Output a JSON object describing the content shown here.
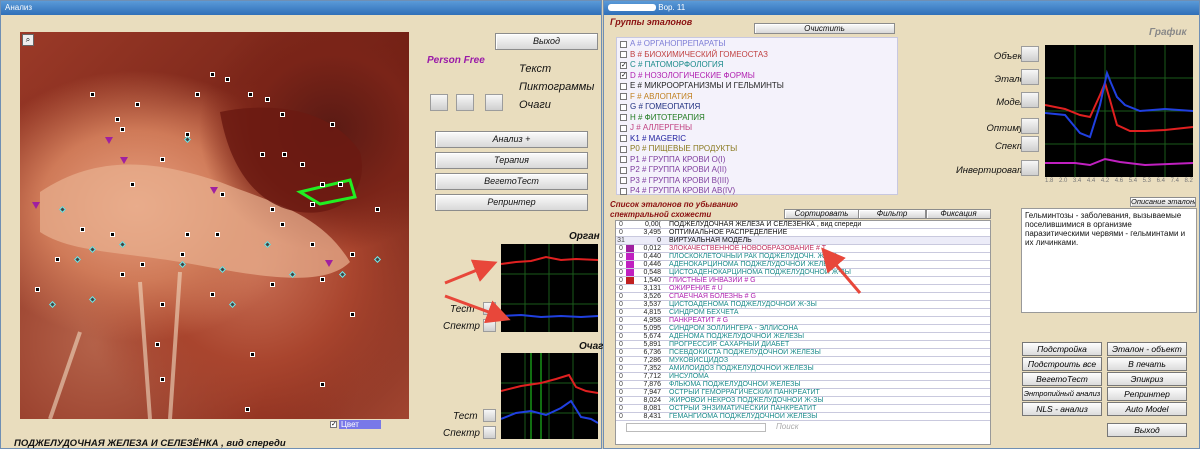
{
  "left": {
    "window_title": "Анализ",
    "exit_label": "Выход",
    "person_label": "Person Free",
    "text_label": "Текст",
    "pict_label": "Пиктограммы",
    "foci_label": "Очаги",
    "buttons": [
      "Анализ +",
      "Терапия",
      "ВегетоТест",
      "Репринтер"
    ],
    "organ_label": "Орган",
    "foci_graph_label": "Очаг",
    "test_label": "Тест",
    "spectr_label": "Спектр",
    "caption": "ПОДЖЕЛУДОЧНАЯ  ЖЕЛЕЗА  И  СЕЛЕЗЁНКА , вид спереди",
    "color_checkbox_label": "Цвет"
  },
  "right": {
    "window_title": "Вор. 11",
    "groups_title": "Группы эталонов",
    "clear_label": "Очистить",
    "groups": [
      {
        "text": "A # ОРГАНОПРЕПАРАТЫ",
        "color": "#7d7dd6",
        "checked": false
      },
      {
        "text": "B # БИОХИМИЧЕСКИЙ  ГОМЕОСТАЗ",
        "color": "#c04040",
        "checked": false
      },
      {
        "text": "C # ПАТОМОРФОЛОГИЯ",
        "color": "#1a8a8a",
        "checked": true
      },
      {
        "text": "D # НОЗОЛОГИЧЕСКИЕ  ФОРМЫ",
        "color": "#b020b0",
        "checked": true
      },
      {
        "text": "E # МИКРООРГАНИЗМЫ   И   ГЕЛЬМИНТЫ",
        "color": "#222222",
        "checked": false
      },
      {
        "text": "F # АВЛОПАТИЯ",
        "color": "#c08020",
        "checked": false
      },
      {
        "text": "G # ГОМЕОПАТИЯ",
        "color": "#203080",
        "checked": false
      },
      {
        "text": "H # ФИТОТЕРАПИЯ",
        "color": "#207a20",
        "checked": false
      },
      {
        "text": "J # АЛЛЕРГЕНЫ",
        "color": "#c04080",
        "checked": false
      },
      {
        "text": "K1 # MAGERIC",
        "color": "#2020a0",
        "checked": false
      },
      {
        "text": "P0 # ПИЩЕВЫЕ  ПРОДУКТЫ",
        "color": "#8a7a20",
        "checked": false
      },
      {
        "text": "P1 # ГРУППА КРОВИ O(I)",
        "color": "#8040a0",
        "checked": false
      },
      {
        "text": "P2 # ГРУППА КРОВИ A(II)",
        "color": "#8040a0",
        "checked": false
      },
      {
        "text": "P3 # ГРУППА КРОВИ B(III)",
        "color": "#8040a0",
        "checked": false
      },
      {
        "text": "P4 # ГРУППА КРОВИ AB(IV)",
        "color": "#8040a0",
        "checked": false
      }
    ],
    "graph_title": "График",
    "graph_labels": [
      "Объект",
      "Эталон",
      "Модель",
      "Оптимум",
      "Спектр",
      "Инвертировать"
    ],
    "graph_x_ticks": [
      "1.8",
      "2.0",
      "3.4",
      "4.4",
      "4.2",
      "4.6",
      "5.4",
      "5.3",
      "6.4",
      "7.4",
      "8.2"
    ],
    "list_title": "Список эталонов по убыванию спектральной схожести",
    "sort_label": "Сортировать",
    "filter_label": "Фильтр",
    "fix_label": "Фиксация",
    "desc_button": "Описание эталона",
    "description": "Гельминтозы - заболевания, вызываемые поселившимися в организме паразитическими червями - гельминтами и их личинками.",
    "search_label": "Поиск",
    "etalons": [
      {
        "n": "0",
        "val": "0,00(",
        "name": "ПОДЖЕЛУДОЧНАЯ ЖЕЛЕЗА  И  СЕЛЕЗЁНКА , вид спереди",
        "color": "#111111",
        "mark": ""
      },
      {
        "n": "0",
        "val": "3,495",
        "name": "ОПТИМАЛЬНОЕ РАСПРЕДЕЛЕНИЕ",
        "color": "#111111",
        "mark": ""
      },
      {
        "n": "31",
        "val": "0",
        "name": "ВИРТУАЛЬНАЯ МОДЕЛЬ",
        "color": "#111111",
        "mark": ""
      },
      {
        "n": "0",
        "val": "0,012",
        "name": "ЗЛОКАЧЕСТВЕННОЕ  НОВООБРАЗОВАНИЕ # T",
        "color": "#c03060",
        "mark": "#a020a0"
      },
      {
        "n": "0",
        "val": "0,440",
        "name": "ПЛОСКОКЛЕТОЧНЫЙ  РАК  ПОДЖЕЛУДОЧН. Ж-ЗЫ",
        "color": "#1a8a8a",
        "mark": "#c020c0"
      },
      {
        "n": "0",
        "val": "0,446",
        "name": "АДЕНОКАРЦИНОМА  ПОДЖЕЛУДОЧНОЙ  ЖЕЛЕЗЫ",
        "color": "#1a8a8a",
        "mark": "#c020c0"
      },
      {
        "n": "0",
        "val": "0,548",
        "name": "ЦИСТОАДЕНОКАРЦИНОМА  ПОДЖЕЛУДОЧНОЙ  Ж-ЗЫ",
        "color": "#1a8a8a",
        "mark": "#c020c0"
      },
      {
        "n": "0",
        "val": "1,540",
        "name": "ГЛИСТНЫЕ  ИНВАЗИИ # G",
        "color": "#b020b0",
        "mark": "#c02020"
      },
      {
        "n": "0",
        "val": "3,131",
        "name": "ОЖИРЕНИЕ # U",
        "color": "#b020b0",
        "mark": ""
      },
      {
        "n": "0",
        "val": "3,526",
        "name": "СПАЕЧНАЯ  БОЛЕЗНЬ # G",
        "color": "#b020b0",
        "mark": ""
      },
      {
        "n": "0",
        "val": "3,537",
        "name": "ЦИСТОАДЕНОМА  ПОДЖЕЛУДОЧНОЙ  Ж-ЗЫ",
        "color": "#1a8a8a",
        "mark": ""
      },
      {
        "n": "0",
        "val": "4,815",
        "name": "СИНДРОМ  БЕХЧЕТА",
        "color": "#1a8a8a",
        "mark": ""
      },
      {
        "n": "0",
        "val": "4,958",
        "name": "ПАНКРЕАТИТ # G",
        "color": "#b020b0",
        "mark": ""
      },
      {
        "n": "0",
        "val": "5,095",
        "name": "СИНДРОМ  ЗОЛЛИНГЕРА - ЭЛЛИСОНА",
        "color": "#1a8a8a",
        "mark": ""
      },
      {
        "n": "0",
        "val": "5,674",
        "name": "АДЕНОМА  ПОДЖЕЛУДОЧНОЙ  ЖЕЛЕЗЫ",
        "color": "#1a8a8a",
        "mark": ""
      },
      {
        "n": "0",
        "val": "5,891",
        "name": "ПРОГРЕССИР. САХАРНЫЙ  ДИАБЕТ",
        "color": "#1a8a8a",
        "mark": ""
      },
      {
        "n": "0",
        "val": "6,736",
        "name": "ПСЕВДОКИСТА  ПОДЖЕЛУДОЧНОЙ  ЖЕЛЕЗЫ",
        "color": "#1a8a8a",
        "mark": ""
      },
      {
        "n": "0",
        "val": "7,286",
        "name": "МУКОВИСЦИДОЗ",
        "color": "#1a8a8a",
        "mark": ""
      },
      {
        "n": "0",
        "val": "7,352",
        "name": "АМИЛОИДОЗ  ПОДЖЕЛУДОЧНОЙ  ЖЕЛЕЗЫ",
        "color": "#1a8a8a",
        "mark": ""
      },
      {
        "n": "0",
        "val": "7,712",
        "name": "ИНСУЛОМА",
        "color": "#1a8a8a",
        "mark": ""
      },
      {
        "n": "0",
        "val": "7,876",
        "name": "ФЛЬЮМА  ПОДЖЕЛУДОЧНОЙ  ЖЕЛЕЗЫ",
        "color": "#1a8a8a",
        "mark": ""
      },
      {
        "n": "0",
        "val": "7,947",
        "name": "ОСТРЫЙ  ГЕМОРРАГИЧЕСКИЙ  ПАНКРЕАТИТ",
        "color": "#1a8a8a",
        "mark": ""
      },
      {
        "n": "0",
        "val": "8,024",
        "name": "ЖИРОВОЙ  НЕКРОЗ  ПОДЖЕЛУДОЧНОЙ  Ж-ЗЫ",
        "color": "#1a8a8a",
        "mark": ""
      },
      {
        "n": "0",
        "val": "8,081",
        "name": "ОСТРЫЙ  ЭНЗИМАТИЧЕСКИЙ  ПАНКРЕАТИТ",
        "color": "#1a8a8a",
        "mark": ""
      },
      {
        "n": "0",
        "val": "8,431",
        "name": "ГЕМАНГИОМА  ПОДЖЕЛУДОЧНОЙ  ЖЕЛЕЗЫ",
        "color": "#1a8a8a",
        "mark": ""
      }
    ],
    "buttons": [
      [
        "Подстройка",
        "Эталон - объект"
      ],
      [
        "Подстроить все",
        "В печать"
      ],
      [
        "ВегетоТест",
        "Эпикриз"
      ],
      [
        "Энтропийный анализ",
        "Репринтер"
      ],
      [
        "NLS - анализ",
        "Auto Model"
      ]
    ],
    "exit_label": "Выход"
  }
}
